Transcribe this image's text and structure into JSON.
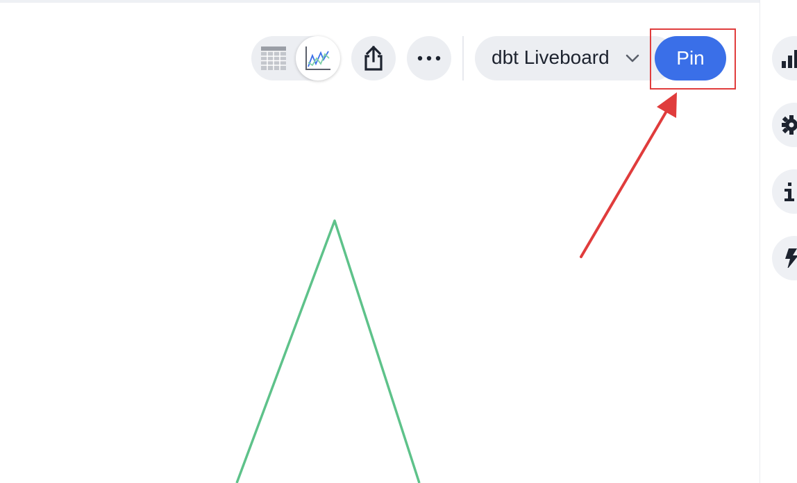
{
  "toolbar": {
    "view_toggle": {
      "table_icon": "table-grid-icon",
      "chart_icon": "line-chart-icon",
      "selected": "chart"
    },
    "share_icon": "share-upload-icon",
    "more_icon": "ellipsis-icon",
    "liveboard_select": {
      "value": "dbt Liveboard",
      "icon": "chevron-down-icon"
    },
    "pin_label": "Pin"
  },
  "right_rail": {
    "icons": [
      "bar-chart-icon",
      "gear-icon",
      "info-icon",
      "lightning-icon"
    ]
  },
  "annotation": {
    "highlight_color": "#e03c3c",
    "arrow_color": "#e03c3c"
  },
  "colors": {
    "pin_button": "#3a6fe8",
    "chart_line": "#5ec28a",
    "pill_background": "#eceef2"
  }
}
